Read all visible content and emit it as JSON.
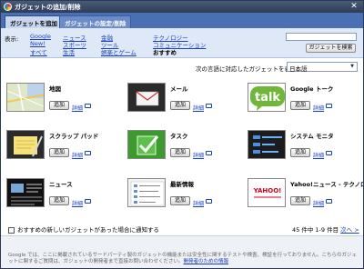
{
  "window": {
    "title": "ガジェットの追加/削除",
    "close_glyph": "✕"
  },
  "tabs": [
    {
      "label": "ガジェットを追加"
    },
    {
      "label": "ガジェットの設定/削除"
    }
  ],
  "categories": {
    "label": "表示:",
    "items": [
      "Google",
      "New!",
      "すべて",
      "ニュース",
      "スポーツ",
      "生活",
      "金融",
      "ツール",
      "娯楽とゲーム",
      "テクノロジー",
      "コミュニケーション",
      "おすすめ"
    ],
    "selected": "おすすめ"
  },
  "search": {
    "value": "",
    "button_label": "ガジェットを検索"
  },
  "language": {
    "prompt": "次の言語に対応したガジェットを表示:",
    "selected": "日本語"
  },
  "gadget_common": {
    "add_label": "追加",
    "detail_label": "詳細"
  },
  "gadgets": [
    {
      "name": "地図"
    },
    {
      "name": "メール"
    },
    {
      "name": "Google トーク",
      "logo_text": "talk"
    },
    {
      "name": "スクラップ パッド"
    },
    {
      "name": "タスク"
    },
    {
      "name": "システム モニタ"
    },
    {
      "name": "ニュース"
    },
    {
      "name": "最新情報"
    },
    {
      "name": "Yahoo!ニュース - テクノロジー",
      "logo_text": "YAHOO!"
    }
  ],
  "notify": {
    "label": "おすすめの新しいガジェットがあった場合に通知する",
    "checked": false
  },
  "pager": {
    "text": "45 件中 1-9 件目",
    "next_label": "次へ >"
  },
  "footer": {
    "text": "Google では、ここに掲載されているサードパーティ製のガジェットの機能または安全性に関するテストや検査、検証を行っておりません。こちらのガジェットに関するご質問は、ガジェットの開発者まで直接お問い合わせください。",
    "link": "開発者のための情報"
  },
  "colors": {
    "tab_bar": "#4a6fb3",
    "link": "#1a3fbf",
    "title_bar": "#3a4a66"
  }
}
